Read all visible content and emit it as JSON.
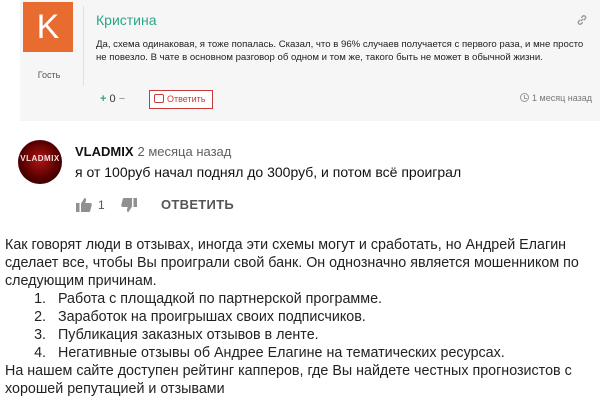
{
  "comment1": {
    "avatar_letter": "K",
    "avatar_color": "#e86b2f",
    "role": "Гость",
    "author": "Кристина",
    "text": "Да, схема одинаковая, я тоже попалась. Сказал, что в 96% случаев получается с первого раза, и мне просто не повезло. В чате в основном разговор об одном и том же, такого быть не может в обычной жизни.",
    "vote_plus": "+",
    "vote_count": "0",
    "vote_minus": "−",
    "reply_label": "Ответить",
    "time": "1 месяц назад",
    "link_icon": "link-icon",
    "accent_color": "#2aa58a"
  },
  "comment2": {
    "avatar_text": "VLADMIX",
    "author": "VLADMIX",
    "date": "2 месяца назад",
    "text": "я от 100руб начал поднял до 300руб, и потом всё проиграл",
    "likes": "1",
    "reply_label": "ОТВЕТИТЬ"
  },
  "article": {
    "intro": "Как говорят люди в отзывах, иногда эти схемы могут и сработать, но Андрей Елагин сделает все, чтобы Вы проиграли свой банк. Он однозначно является мошенником по следующим причинам.",
    "reasons": [
      "Работа с площадкой по партнерской программе.",
      "Заработок на проигрышах своих подписчиков.",
      "Публикация заказных отзывов в ленте.",
      "Негативные отзывы об Андрее Елагине на тематических ресурсах."
    ],
    "outro": "На нашем сайте доступен рейтинг капперов, где Вы найдете честных прогнозистов с хорошей репутацией и отзывами"
  }
}
